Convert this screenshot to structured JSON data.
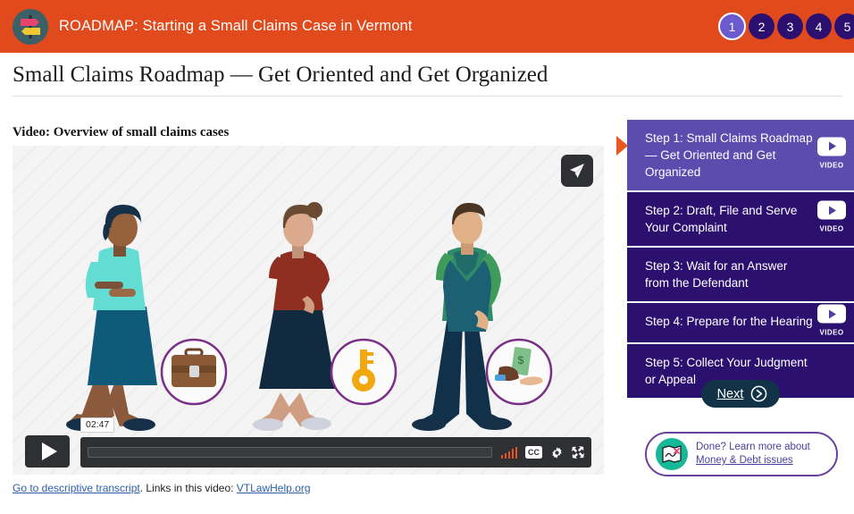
{
  "header": {
    "logo_icon": "signpost-icon",
    "title": "ROADMAP: Starting a Small Claims Case in Vermont",
    "brand_color": "#e04a1c",
    "steps_nav": [
      "1",
      "2",
      "3",
      "4",
      "5"
    ],
    "active_step": "1",
    "active_color": "#6a5acd",
    "inactive_color": "#2b1070"
  },
  "page": {
    "title": "Small Claims Roadmap — Get Oriented and Get Organized"
  },
  "video_section": {
    "caption": "Video: Overview of small claims cases",
    "share_icon": "paper-plane-icon",
    "controls": {
      "play_icon": "play-icon",
      "time": "02:47",
      "volume_icon": "volume-bars-icon",
      "cc_label": "CC",
      "settings_icon": "gear-icon",
      "fullscreen_icon": "fullscreen-icon"
    },
    "scene": {
      "figure_1_icon": "briefcase-icon",
      "figure_2_icon": "key-icon",
      "figure_3_icon": "money-in-hand-icon"
    },
    "transcript_link": "Go to descriptive transcript",
    "transcript_middle": ". Links in this video: ",
    "video_link": "VTLawHelp.org"
  },
  "sidebar": {
    "steps": [
      {
        "label": "Step 1: Small Claims Roadmap — Get Oriented and Get Organized",
        "has_video": true,
        "video_label": "VIDEO",
        "active": true
      },
      {
        "label": "Step 2: Draft, File and Serve Your Complaint",
        "has_video": true,
        "video_label": "VIDEO",
        "active": false
      },
      {
        "label": "Step 3: Wait for an Answer from the Defendant",
        "has_video": false,
        "video_label": "",
        "active": false
      },
      {
        "label": "Step 4: Prepare for the Hearing",
        "has_video": true,
        "video_label": "VIDEO",
        "active": false
      },
      {
        "label": "Step 5: Collect Your Judgment or Appeal",
        "has_video": false,
        "video_label": "",
        "active": false
      }
    ],
    "next_button": "Next",
    "next_icon": "chevron-right-circle-icon",
    "callout": {
      "icon": "map-marker-icon",
      "line1": "Done? Learn more about",
      "line2": "Money & Debt issues"
    }
  }
}
